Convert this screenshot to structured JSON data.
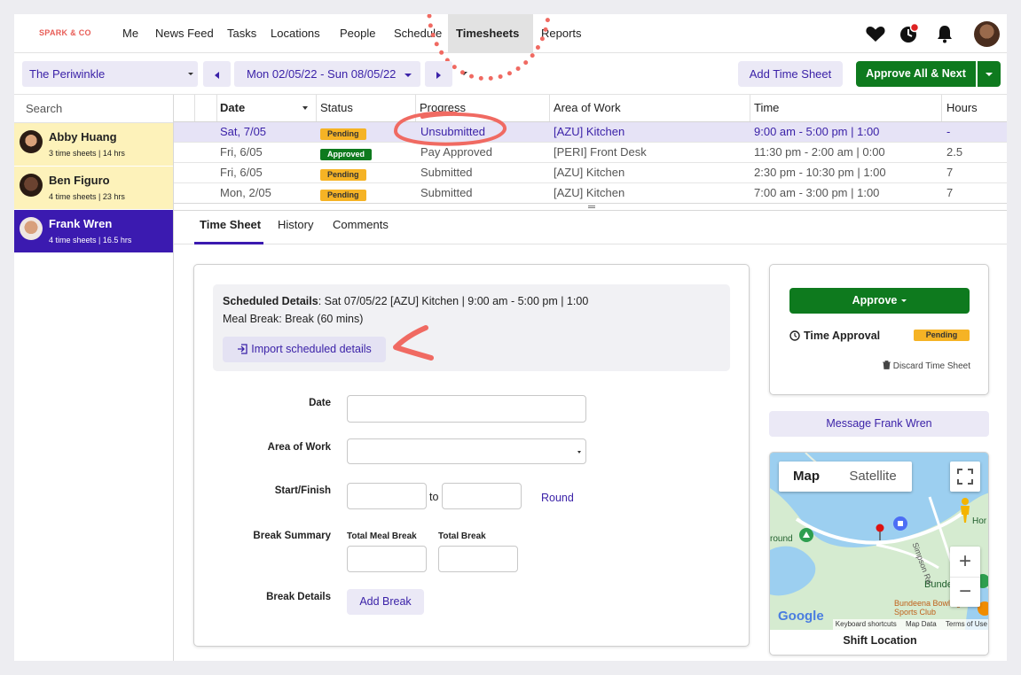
{
  "brand": "SPARK & CO",
  "nav": [
    "Me",
    "News Feed",
    "Tasks",
    "Locations",
    "People",
    "Schedule",
    "Timesheets",
    "Reports"
  ],
  "toolbar": {
    "location": "The Periwinkle",
    "date_range": "Mon 02/05/22 - Sun 08/05/22",
    "add_time_sheet": "Add Time Sheet",
    "approve_all": "Approve All & Next"
  },
  "sidebar": {
    "search": "Search",
    "employees": [
      {
        "name": "Abby Huang",
        "summary": "3 time sheets | 14 hrs"
      },
      {
        "name": "Ben Figuro",
        "summary": "4 time sheets | 23 hrs"
      },
      {
        "name": "Frank Wren",
        "summary": "4 time sheets | 16.5 hrs"
      }
    ]
  },
  "grid": {
    "headers": [
      "Date",
      "Status",
      "Progress",
      "Area of Work",
      "Time",
      "Hours"
    ],
    "rows": [
      {
        "date": "Sat, 7/05",
        "status": "Pending",
        "progress": "Unsubmitted",
        "area": "[AZU] Kitchen",
        "time": "9:00 am - 5:00 pm | 1:00",
        "hours": "-"
      },
      {
        "date": "Fri, 6/05",
        "status": "Approved",
        "progress": "Pay Approved",
        "area": "[PERI] Front Desk",
        "time": "11:30 pm - 2:00 am | 0:00",
        "hours": "2.5"
      },
      {
        "date": "Fri, 6/05",
        "status": "Pending",
        "progress": "Submitted",
        "area": "[AZU] Kitchen",
        "time": "2:30 pm - 10:30 pm | 1:00",
        "hours": "7"
      },
      {
        "date": "Mon, 2/05",
        "status": "Pending",
        "progress": "Submitted",
        "area": "[AZU] Kitchen",
        "time": "7:00 am - 3:00 pm | 1:00",
        "hours": "7"
      }
    ]
  },
  "tabs": [
    "Time Sheet",
    "History",
    "Comments"
  ],
  "form": {
    "scheduled_label": "Scheduled Details",
    "scheduled_value": ": Sat 07/05/22 [AZU] Kitchen | 9:00 am - 5:00 pm | 1:00",
    "meal_break": "Meal Break: Break (60 mins)",
    "import_button": "Import scheduled details",
    "date_label": "Date",
    "area_label": "Area of Work",
    "start_finish_label": "Start/Finish",
    "to": "to",
    "round": "Round",
    "break_summary_label": "Break Summary",
    "total_meal_break": "Total Meal Break",
    "total_break": "Total Break",
    "break_details_label": "Break Details",
    "add_break": "Add Break"
  },
  "approval": {
    "approve": "Approve",
    "time_approval": "Time Approval",
    "status": "Pending",
    "discard": "Discard Time Sheet",
    "message": "Message Frank Wren"
  },
  "map": {
    "tab_map": "Map",
    "tab_satellite": "Satellite",
    "labels": [
      "Bundeena",
      "Bundeena Bowling and Sports Club",
      "Simpson Rd",
      "round",
      "Hor"
    ],
    "footer": [
      "Keyboard shortcuts",
      "Map Data",
      "Terms of Use"
    ],
    "google": "Google",
    "caption": "Shift Location"
  },
  "colors": {
    "accent": "#3b1ab0",
    "green": "#0e7a1e",
    "pending": "#f5b325",
    "highlight": "#fdf2ba",
    "annotation": "#f06a62"
  }
}
